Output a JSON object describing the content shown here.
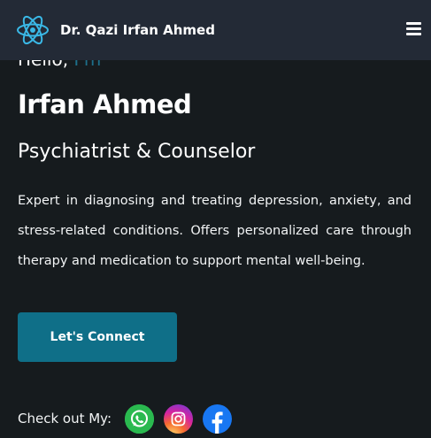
{
  "navbar": {
    "brand_title": "Dr. Qazi Irfan Ahmed",
    "logo_icon": "react-atom-icon",
    "menu_icon": "hamburger-menu-icon"
  },
  "hero": {
    "greeting_prefix": "Hello,",
    "greeting_accent": "I'm",
    "name": "Irfan Ahmed",
    "role": "Psychiatrist & Counselor",
    "bio": "Expert in diagnosing and treating depression, anxiety, and stress-related conditions. Offers personalized care through therapy and medication to support mental well-being.",
    "cta_label": "Let's Connect"
  },
  "social": {
    "label": "Check out My:",
    "links": [
      {
        "name": "whatsapp-icon",
        "color": "#25d366"
      },
      {
        "name": "instagram-icon",
        "color": "#d6249f"
      },
      {
        "name": "facebook-icon",
        "color": "#1877f2"
      }
    ]
  },
  "colors": {
    "background": "#161b1e",
    "navbar": "#232a36",
    "accent": "#0f6f88",
    "logo": "#3ab8e6"
  }
}
